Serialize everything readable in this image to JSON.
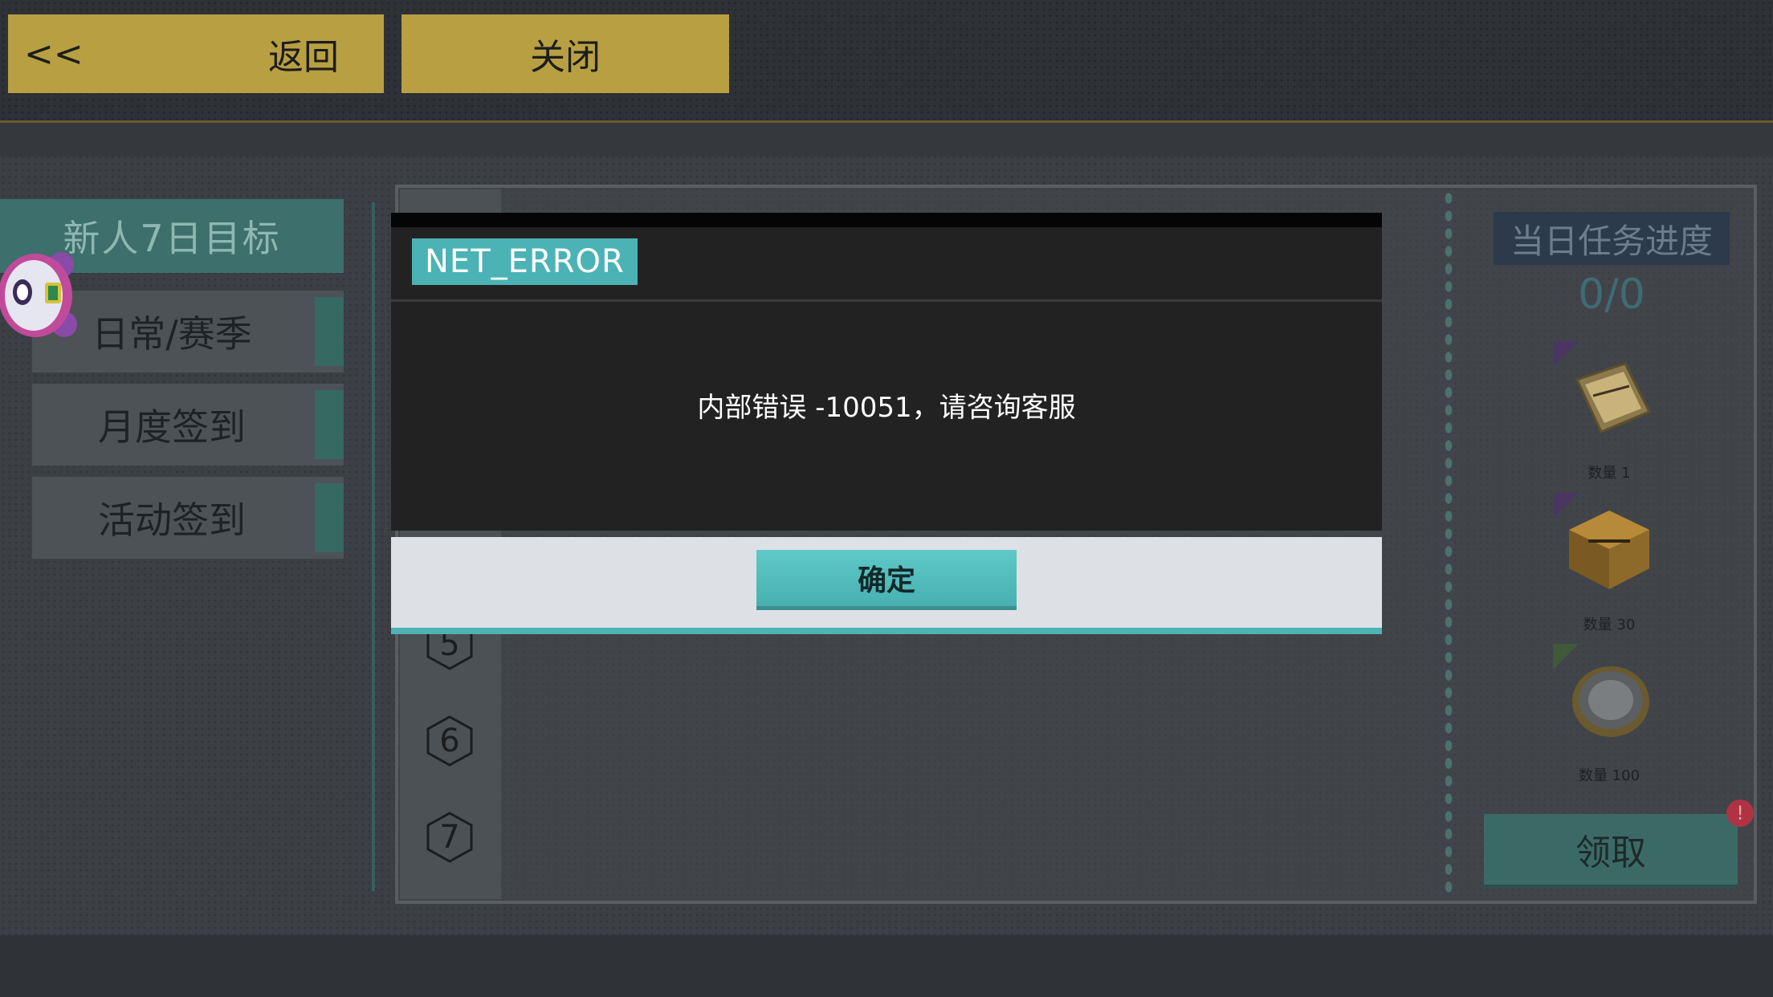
{
  "header": {
    "back_arrow": "<<",
    "back_label": "返回",
    "close_label": "关闭"
  },
  "sidebar": {
    "title": "新人7日目标",
    "items": [
      {
        "label": "日常/赛季"
      },
      {
        "label": "月度签到"
      },
      {
        "label": "活动签到"
      }
    ]
  },
  "days": {
    "visible": [
      "5",
      "6",
      "7"
    ]
  },
  "progress": {
    "title": "当日任务进度",
    "value": "0/0"
  },
  "rewards": [
    {
      "icon": "ticket-icon",
      "qty": "数量 1"
    },
    {
      "icon": "gold-crate-icon",
      "qty": "数量 30"
    },
    {
      "icon": "coin-icon",
      "qty": "数量 100"
    }
  ],
  "claim": {
    "label": "领取",
    "badge": "!"
  },
  "dialog": {
    "title": "NET_ERROR",
    "message": "内部错误 -10051，请咨询客服",
    "ok_label": "确定"
  },
  "colors": {
    "gold_button": "#b8a042",
    "teal_accent": "#4bb3b6",
    "dialog_body": "#222222",
    "dialog_footer": "#dde1e6"
  }
}
